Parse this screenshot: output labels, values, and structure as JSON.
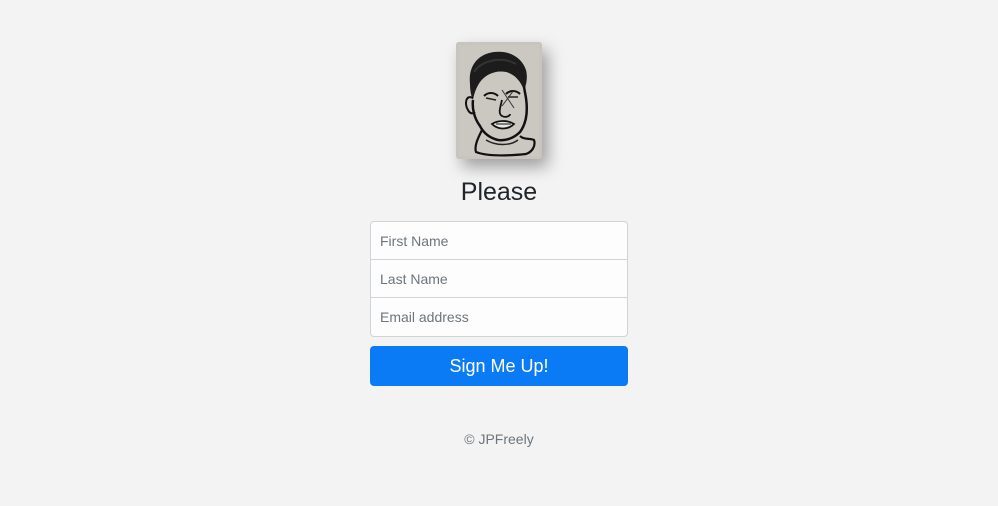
{
  "header": {
    "title": "Please"
  },
  "signup_form": {
    "first_name_placeholder": "First Name",
    "last_name_placeholder": "Last Name",
    "email_placeholder": "Email address",
    "first_name_value": "",
    "last_name_value": "",
    "email_value": "",
    "submit_label": "Sign Me Up!"
  },
  "footer": {
    "copyright": "© JPFreely"
  },
  "colors": {
    "background": "#f3f3f3",
    "primary_button": "#0b7bf5",
    "footer_text": "#6c757d"
  },
  "images": {
    "portrait": "hand-drawn-face-sketch"
  }
}
